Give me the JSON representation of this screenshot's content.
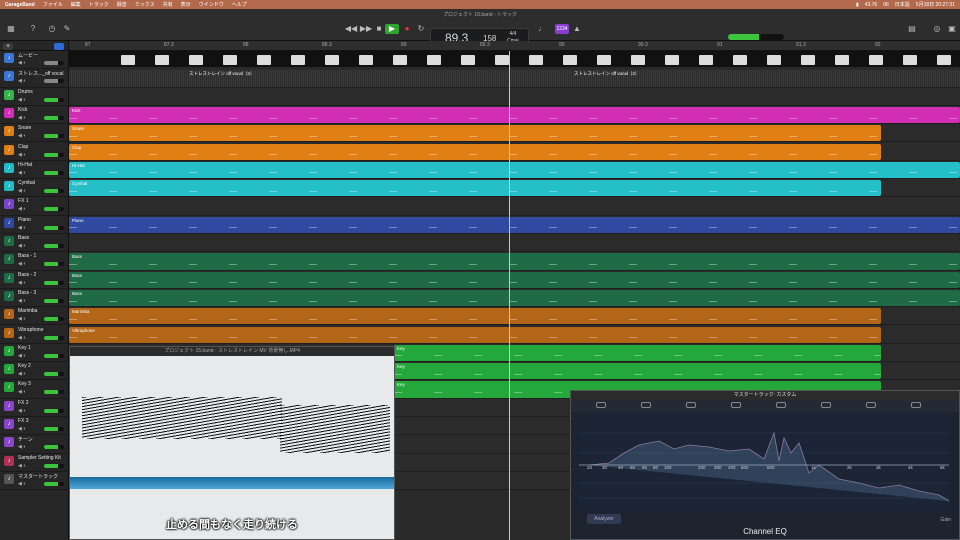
{
  "menubar": {
    "items": [
      "GarageBand",
      "ファイル",
      "編集",
      "トラック",
      "録音",
      "ミックス",
      "共有",
      "表示",
      "ウインドウ",
      "ヘルプ"
    ],
    "battery": "43.76",
    "wifi_value": "06",
    "input": "日本語",
    "clock": "5月18日 20:27:31"
  },
  "window": {
    "title": "プロジェクト 15.band - トラック"
  },
  "lcd": {
    "position": "89.3",
    "tempo": "158",
    "signature": "4/4",
    "key": "Cmaj"
  },
  "badge": {
    "label": "1234"
  },
  "master_volume": 0.55,
  "ruler": [
    {
      "label": "87"
    },
    {
      "label": "87.3"
    },
    {
      "label": "88"
    },
    {
      "label": "88.3"
    },
    {
      "label": "89"
    },
    {
      "label": "89.3"
    },
    {
      "label": "90"
    },
    {
      "label": "90.3"
    },
    {
      "label": "91"
    },
    {
      "label": "91.3"
    },
    {
      "label": "92"
    }
  ],
  "tracks": [
    {
      "name": "ムービー",
      "color": "#3b75d6"
    },
    {
      "name": "ストレス..._off vocal",
      "color": "#3b75d6"
    },
    {
      "name": "Drums",
      "color": "#37b24d"
    },
    {
      "name": "Kick",
      "color": "#d12db5"
    },
    {
      "name": "Snare",
      "color": "#e07f14"
    },
    {
      "name": "Clap",
      "color": "#e07f14"
    },
    {
      "name": "Hi-Hat",
      "color": "#1fbcc7"
    },
    {
      "name": "Cymbal",
      "color": "#1fbcc7"
    },
    {
      "name": "FX 1",
      "color": "#7a46c9"
    },
    {
      "name": "Piano",
      "color": "#2f4aa0"
    },
    {
      "name": "Bass",
      "color": "#1f6b45"
    },
    {
      "name": "Bass - 1",
      "color": "#1f6b45"
    },
    {
      "name": "Bass - 2",
      "color": "#1f6b45"
    },
    {
      "name": "Bass - 3",
      "color": "#1f6b45"
    },
    {
      "name": "Marimba",
      "color": "#b36518"
    },
    {
      "name": "Vibraphone",
      "color": "#b36518"
    },
    {
      "name": "Key 1",
      "color": "#24a73b"
    },
    {
      "name": "Key 2",
      "color": "#24a73b"
    },
    {
      "name": "Key 3",
      "color": "#24a73b"
    },
    {
      "name": "FX 2",
      "color": "#8a46c9"
    },
    {
      "name": "FX 3",
      "color": "#8a46c9"
    },
    {
      "name": "チーン",
      "color": "#8a46c9"
    },
    {
      "name": "Sampler Setting Kit",
      "color": "#b0305a"
    },
    {
      "name": "マスタートラック",
      "color": "#555555"
    }
  ],
  "audio_region_label": "ストレストレイン off vocal（2）",
  "regions": {
    "kick": "Kick",
    "snare": "Snare",
    "clap": "Clap",
    "hihat": "Hi-Hat",
    "cymbal": "Cymbal",
    "piano": "Piano",
    "bass": "Bass",
    "marimba": "Marimba",
    "vibraphone": "Vibraphone",
    "key": "Key"
  },
  "video": {
    "title": "プロジェクト 15.band - ストレストレイン MV 背景無し.MP4",
    "subtitle": "止める間もなく走り続ける"
  },
  "eq": {
    "title": "マスタートラック: カスタム",
    "freqs": [
      "20",
      "30",
      "40",
      "50",
      "60",
      "80",
      "100",
      "200",
      "300",
      "400",
      "500",
      "800",
      "1k",
      "2k",
      "3k",
      "4k",
      "6k",
      "8k",
      "10k",
      "20k"
    ],
    "db": [
      "+",
      "+",
      "",
      "",
      "",
      "",
      "",
      "",
      "-",
      "-",
      "-",
      "-",
      "-",
      "-",
      "-",
      "-",
      "-"
    ],
    "analyzer": "Analyzer",
    "name": "Channel EQ",
    "gain": "Gain"
  }
}
